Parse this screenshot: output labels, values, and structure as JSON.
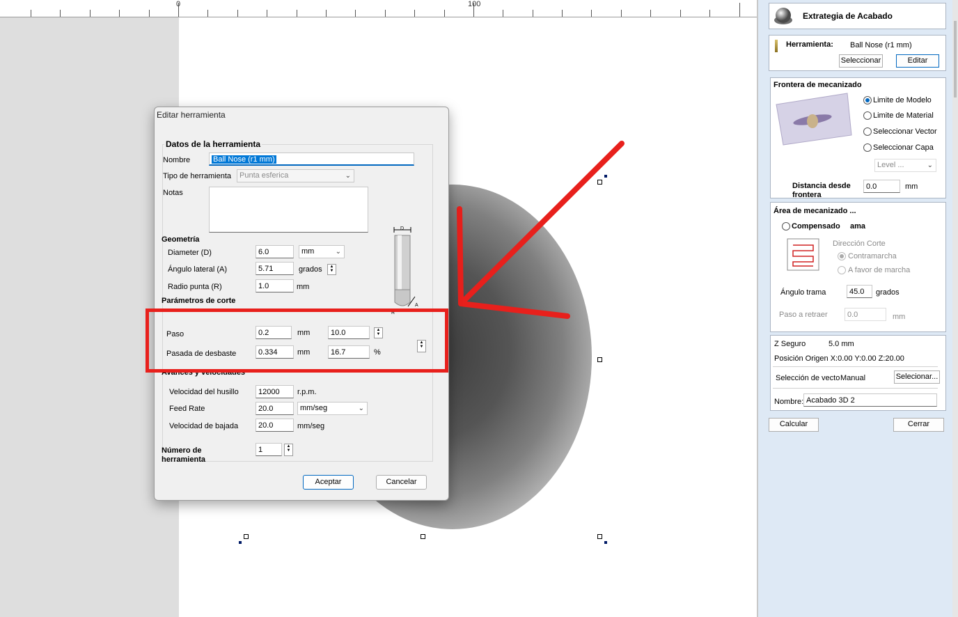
{
  "ruler": {
    "label_zero": "0",
    "label_hundred": "100"
  },
  "dialog": {
    "title": "Editar herramienta",
    "group_title": "Datos de la herramienta",
    "name_label": "Nombre",
    "name_value": "Ball Nose (r1 mm)",
    "tool_type_label": "Tipo de herramienta",
    "tool_type_value": "Punta esferica",
    "notes_label": "Notas",
    "geometry_title": "Geometría",
    "diameter_label": "Diameter (D)",
    "diameter_value": "6.0",
    "diameter_unit": "mm",
    "angle_label": "Ángulo lateral (A)",
    "angle_value": "5.71",
    "angle_unit": "grados",
    "radius_label": "Radio punta (R)",
    "radius_value": "1.0",
    "radius_unit": "mm",
    "diagram_d": "D",
    "diagram_r": "R",
    "diagram_a": "A",
    "cut_params_title": "Parámetros de corte",
    "step_label": "Paso",
    "step_value": "0.2",
    "step_unit": "mm",
    "step_percent": "10.0",
    "pass_label": "Pasada de desbaste",
    "pass_value": "0.334",
    "pass_unit": "mm",
    "pass_percent": "16.7",
    "percent_sign": "%",
    "feeds_title": "Avances y velocidades",
    "spindle_label": "Velocidad del husillo",
    "spindle_value": "12000",
    "spindle_unit": "r.p.m.",
    "feed_label": "Feed Rate",
    "feed_value": "20.0",
    "feed_unit": "mm/seg",
    "plunge_label": "Velocidad de bajada",
    "plunge_value": "20.0",
    "plunge_unit": "mm/seg",
    "tool_number_label_1": "Número de",
    "tool_number_label_2": "herramienta",
    "tool_number_value": "1",
    "accept_label": "Aceptar",
    "cancel_label": "Cancelar"
  },
  "panel": {
    "header_title": "Extrategia de Acabado",
    "tool_label": "Herramienta:",
    "tool_value": "Ball Nose (r1 mm)",
    "select_btn": "Seleccionar",
    "edit_btn": "Editar",
    "boundary_title": "Frontera de mecanizado",
    "boundary_options": [
      "Limite de Modelo",
      "Limite de Material",
      "Seleccionar Vector",
      "Seleccionar Capa"
    ],
    "level_select": "Level ...",
    "distance_label_1": "Distancia desde",
    "distance_label_2": "frontera",
    "distance_value": "0.0",
    "distance_unit": "mm",
    "area_title": "Área de mecanizado ...",
    "compensated_label": "Compensado",
    "compensated_suffix": "ama",
    "direction_label": "Dirección Corte",
    "direction_options": [
      "Contramarcha",
      "A favor de marcha"
    ],
    "raster_angle_label": "Ángulo trama",
    "raster_angle_value": "45.0",
    "raster_angle_unit": "grados",
    "retract_label": "Paso a retraer",
    "retract_value": "0.0",
    "retract_unit": "mm",
    "z_safe_label": "Z Seguro",
    "z_safe_value": "5.0 mm",
    "origin_label": "Posición Origen X:0.00 Y:0.00 Z:20.00",
    "vector_sel_label": "Selección de vecto",
    "vector_sel_value": "Manual",
    "vector_sel_btn": "Selecionar...",
    "name_label": "Nombre:",
    "name_value": "Acabado 3D 2",
    "calc_btn": "Calcular",
    "close_btn": "Cerrar"
  },
  "colors": {
    "annotation_red": "#e8201c",
    "accent_blue": "#0067c0"
  }
}
